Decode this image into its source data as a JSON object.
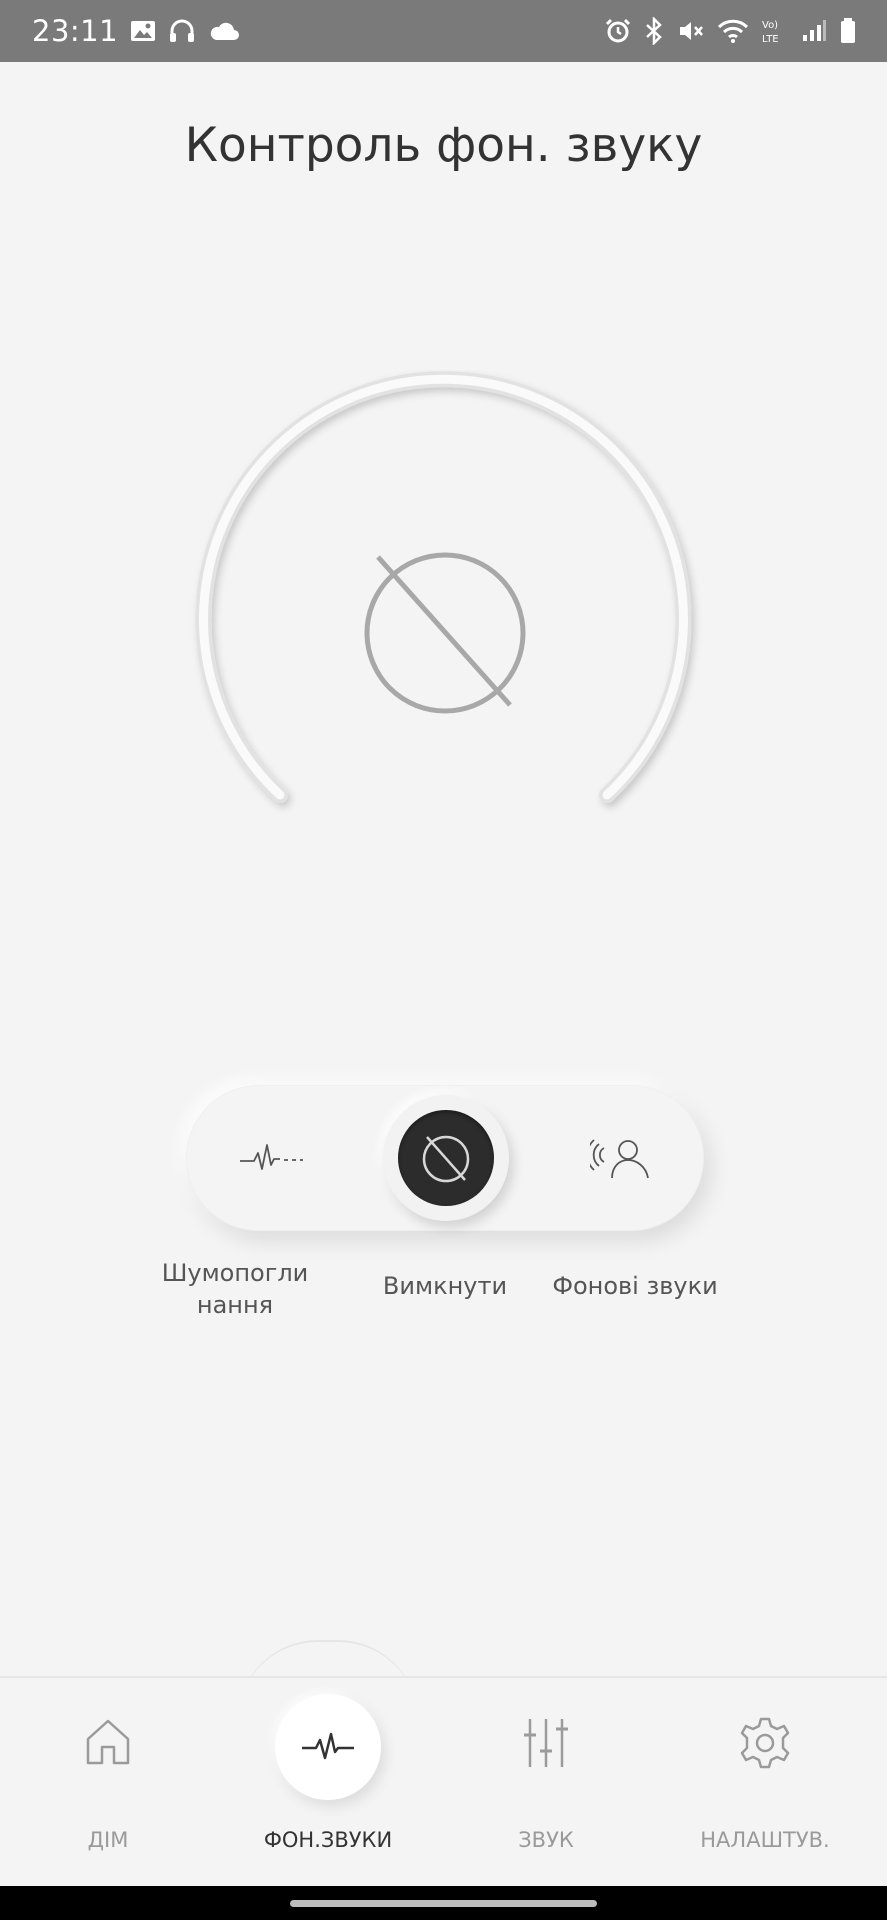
{
  "status_bar": {
    "time": "23:11",
    "left_icons": [
      "gallery-icon",
      "headphones-icon",
      "cloud-icon"
    ],
    "right_icons": [
      "alarm-icon",
      "bluetooth-icon",
      "mute-icon",
      "wifi-icon",
      "volte-icon",
      "signal-icon",
      "battery-icon"
    ],
    "volte_text": "Vo) LTE"
  },
  "page": {
    "title": "Контроль фон. звуку"
  },
  "gauge": {
    "center_icon": "off-icon"
  },
  "modes": {
    "selected": "off",
    "items": [
      {
        "id": "anc",
        "label": "Шумопоглинання",
        "icon": "noise-cancelling-icon"
      },
      {
        "id": "off",
        "label": "Вимкнути",
        "icon": "off-icon"
      },
      {
        "id": "ambient",
        "label": "Фонові звуки",
        "icon": "ambient-sound-icon"
      }
    ]
  },
  "nav": {
    "active": "anc",
    "items": [
      {
        "id": "home",
        "label": "ДІМ",
        "icon": "home-icon"
      },
      {
        "id": "anc",
        "label": "ФОН.ЗВУКИ",
        "icon": "pulse-icon"
      },
      {
        "id": "sound",
        "label": "ЗВУК",
        "icon": "equalizer-icon"
      },
      {
        "id": "settings",
        "label": "НАЛАШТУВ.",
        "icon": "gear-icon"
      }
    ]
  },
  "colors": {
    "background": "#f4f4f4",
    "status_bar": "#7a7a7a",
    "selected_knob": "#2c2c2c",
    "text_primary": "#333333",
    "text_muted": "#9a9a9a"
  }
}
